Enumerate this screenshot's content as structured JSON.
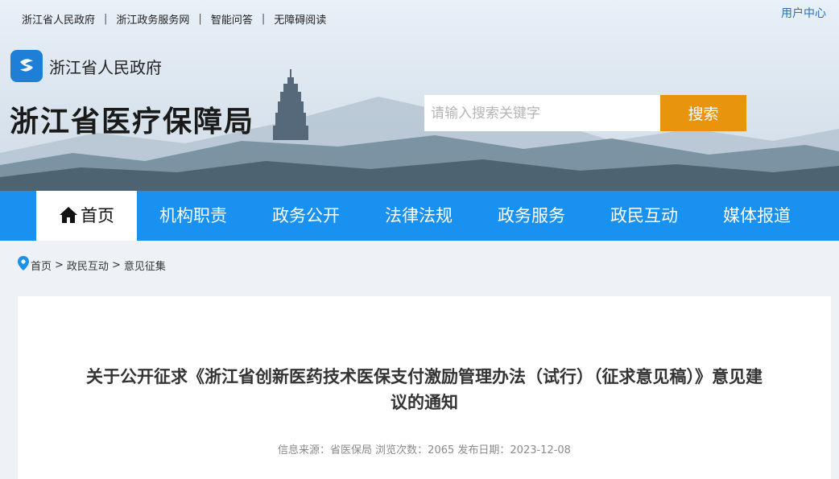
{
  "topbar": {
    "links": [
      "浙江省人民政府",
      "浙江政务服务网",
      "智能问答",
      "无障碍阅读"
    ],
    "separator": "|",
    "user_center": "用户中心"
  },
  "header": {
    "gov_name": "浙江省人民政府",
    "site_title": "浙江省医疗保障局"
  },
  "search": {
    "placeholder": "请输入搜索关键字",
    "button_label": "搜索"
  },
  "nav": {
    "items": [
      "首页",
      "机构职责",
      "政务公开",
      "法律法规",
      "政务服务",
      "政民互动",
      "媒体报道"
    ],
    "active": "首页"
  },
  "breadcrumb": {
    "items": [
      "首页",
      "政民互动",
      "意见征集"
    ],
    "separator": ">"
  },
  "article": {
    "title": "关于公开征求《浙江省创新医药技术医保支付激励管理办法（试行）（征求意见稿）》意见建议的通知",
    "meta": "信息来源：省医保局 浏览次数：2065 发布日期：2023-12-08"
  },
  "colors": {
    "nav_bg": "#1891f0",
    "search_button": "#e8950d",
    "emblem": "#1f7fd6",
    "user_center": "#2a6fb8"
  },
  "icons": [
    "emblem-icon",
    "home-icon",
    "location-pin-icon"
  ]
}
